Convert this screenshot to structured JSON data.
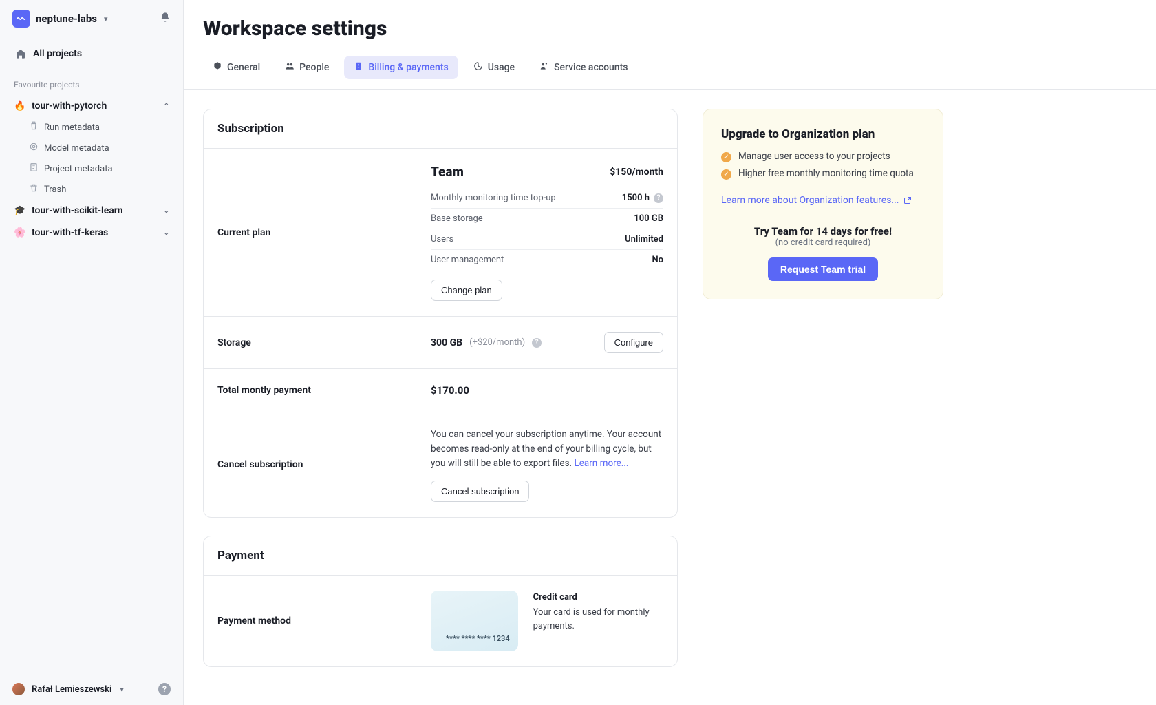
{
  "workspace": {
    "name": "neptune-labs"
  },
  "nav": {
    "all_projects": "All projects",
    "favourites_label": "Favourite projects"
  },
  "projects": [
    {
      "emoji": "🔥",
      "name": "tour-with-pytorch",
      "expanded": true,
      "subitems": [
        "Run metadata",
        "Model metadata",
        "Project metadata",
        "Trash"
      ]
    },
    {
      "emoji": "🎓",
      "name": "tour-with-scikit-learn",
      "expanded": false
    },
    {
      "emoji": "🌸",
      "name": "tour-with-tf-keras",
      "expanded": false
    }
  ],
  "user": {
    "name": "Rafał Lemieszewski"
  },
  "page": {
    "title": "Workspace settings"
  },
  "tabs": [
    "General",
    "People",
    "Billing & payments",
    "Usage",
    "Service accounts"
  ],
  "subscription": {
    "heading": "Subscription",
    "current_label": "Current plan",
    "plan_name": "Team",
    "plan_price": "$150/month",
    "rows": [
      {
        "k": "Monthly monitoring time top-up",
        "v": "1500 h",
        "help": true
      },
      {
        "k": "Base storage",
        "v": "100 GB"
      },
      {
        "k": "Users",
        "v": "Unlimited"
      },
      {
        "k": "User management",
        "v": "No"
      }
    ],
    "change_btn": "Change plan",
    "storage_label": "Storage",
    "storage_value": "300 GB",
    "storage_extra": "(+$20/month)",
    "configure_btn": "Configure",
    "total_label": "Total montly payment",
    "total_value": "$170.00",
    "cancel_label": "Cancel subscription",
    "cancel_text": "You can cancel your subscription anytime. Your account becomes read-only at the end of your billing cycle, but you will still be able to export files.",
    "learn_more": "Learn more...",
    "cancel_btn": "Cancel subscription"
  },
  "payment": {
    "heading": "Payment",
    "method_label": "Payment method",
    "card_number": "**** **** **** 1234",
    "cc_title": "Credit card",
    "cc_desc": "Your card is used for monthly payments."
  },
  "upgrade": {
    "title": "Upgrade to Organization plan",
    "features": [
      "Manage user access to your projects",
      "Higher free monthly monitoring time quota"
    ],
    "link": "Learn more about Organization features...",
    "trial_headline": "Try Team for 14 days for free!",
    "trial_sub": "(no credit card required)",
    "trial_btn": "Request Team trial"
  }
}
